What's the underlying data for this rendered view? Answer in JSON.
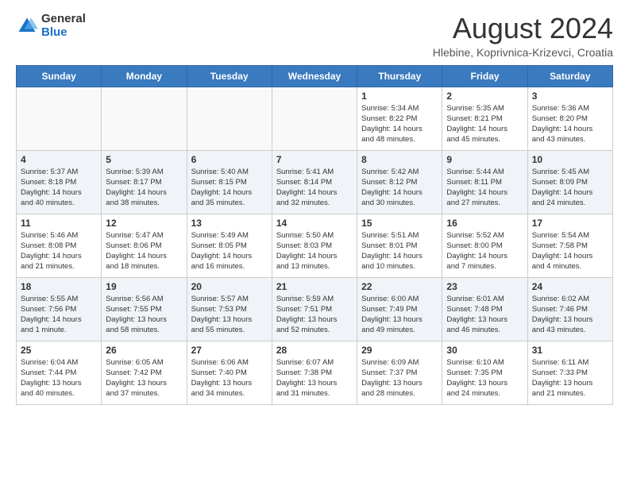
{
  "logo": {
    "general": "General",
    "blue": "Blue"
  },
  "title": "August 2024",
  "location": "Hlebine, Koprivnica-Krizevci, Croatia",
  "days_of_week": [
    "Sunday",
    "Monday",
    "Tuesday",
    "Wednesday",
    "Thursday",
    "Friday",
    "Saturday"
  ],
  "weeks": [
    [
      {
        "day": "",
        "info": ""
      },
      {
        "day": "",
        "info": ""
      },
      {
        "day": "",
        "info": ""
      },
      {
        "day": "",
        "info": ""
      },
      {
        "day": "1",
        "info": "Sunrise: 5:34 AM\nSunset: 8:22 PM\nDaylight: 14 hours\nand 48 minutes."
      },
      {
        "day": "2",
        "info": "Sunrise: 5:35 AM\nSunset: 8:21 PM\nDaylight: 14 hours\nand 45 minutes."
      },
      {
        "day": "3",
        "info": "Sunrise: 5:36 AM\nSunset: 8:20 PM\nDaylight: 14 hours\nand 43 minutes."
      }
    ],
    [
      {
        "day": "4",
        "info": "Sunrise: 5:37 AM\nSunset: 8:18 PM\nDaylight: 14 hours\nand 40 minutes."
      },
      {
        "day": "5",
        "info": "Sunrise: 5:39 AM\nSunset: 8:17 PM\nDaylight: 14 hours\nand 38 minutes."
      },
      {
        "day": "6",
        "info": "Sunrise: 5:40 AM\nSunset: 8:15 PM\nDaylight: 14 hours\nand 35 minutes."
      },
      {
        "day": "7",
        "info": "Sunrise: 5:41 AM\nSunset: 8:14 PM\nDaylight: 14 hours\nand 32 minutes."
      },
      {
        "day": "8",
        "info": "Sunrise: 5:42 AM\nSunset: 8:12 PM\nDaylight: 14 hours\nand 30 minutes."
      },
      {
        "day": "9",
        "info": "Sunrise: 5:44 AM\nSunset: 8:11 PM\nDaylight: 14 hours\nand 27 minutes."
      },
      {
        "day": "10",
        "info": "Sunrise: 5:45 AM\nSunset: 8:09 PM\nDaylight: 14 hours\nand 24 minutes."
      }
    ],
    [
      {
        "day": "11",
        "info": "Sunrise: 5:46 AM\nSunset: 8:08 PM\nDaylight: 14 hours\nand 21 minutes."
      },
      {
        "day": "12",
        "info": "Sunrise: 5:47 AM\nSunset: 8:06 PM\nDaylight: 14 hours\nand 18 minutes."
      },
      {
        "day": "13",
        "info": "Sunrise: 5:49 AM\nSunset: 8:05 PM\nDaylight: 14 hours\nand 16 minutes."
      },
      {
        "day": "14",
        "info": "Sunrise: 5:50 AM\nSunset: 8:03 PM\nDaylight: 14 hours\nand 13 minutes."
      },
      {
        "day": "15",
        "info": "Sunrise: 5:51 AM\nSunset: 8:01 PM\nDaylight: 14 hours\nand 10 minutes."
      },
      {
        "day": "16",
        "info": "Sunrise: 5:52 AM\nSunset: 8:00 PM\nDaylight: 14 hours\nand 7 minutes."
      },
      {
        "day": "17",
        "info": "Sunrise: 5:54 AM\nSunset: 7:58 PM\nDaylight: 14 hours\nand 4 minutes."
      }
    ],
    [
      {
        "day": "18",
        "info": "Sunrise: 5:55 AM\nSunset: 7:56 PM\nDaylight: 14 hours\nand 1 minute."
      },
      {
        "day": "19",
        "info": "Sunrise: 5:56 AM\nSunset: 7:55 PM\nDaylight: 13 hours\nand 58 minutes."
      },
      {
        "day": "20",
        "info": "Sunrise: 5:57 AM\nSunset: 7:53 PM\nDaylight: 13 hours\nand 55 minutes."
      },
      {
        "day": "21",
        "info": "Sunrise: 5:59 AM\nSunset: 7:51 PM\nDaylight: 13 hours\nand 52 minutes."
      },
      {
        "day": "22",
        "info": "Sunrise: 6:00 AM\nSunset: 7:49 PM\nDaylight: 13 hours\nand 49 minutes."
      },
      {
        "day": "23",
        "info": "Sunrise: 6:01 AM\nSunset: 7:48 PM\nDaylight: 13 hours\nand 46 minutes."
      },
      {
        "day": "24",
        "info": "Sunrise: 6:02 AM\nSunset: 7:46 PM\nDaylight: 13 hours\nand 43 minutes."
      }
    ],
    [
      {
        "day": "25",
        "info": "Sunrise: 6:04 AM\nSunset: 7:44 PM\nDaylight: 13 hours\nand 40 minutes."
      },
      {
        "day": "26",
        "info": "Sunrise: 6:05 AM\nSunset: 7:42 PM\nDaylight: 13 hours\nand 37 minutes."
      },
      {
        "day": "27",
        "info": "Sunrise: 6:06 AM\nSunset: 7:40 PM\nDaylight: 13 hours\nand 34 minutes."
      },
      {
        "day": "28",
        "info": "Sunrise: 6:07 AM\nSunset: 7:38 PM\nDaylight: 13 hours\nand 31 minutes."
      },
      {
        "day": "29",
        "info": "Sunrise: 6:09 AM\nSunset: 7:37 PM\nDaylight: 13 hours\nand 28 minutes."
      },
      {
        "day": "30",
        "info": "Sunrise: 6:10 AM\nSunset: 7:35 PM\nDaylight: 13 hours\nand 24 minutes."
      },
      {
        "day": "31",
        "info": "Sunrise: 6:11 AM\nSunset: 7:33 PM\nDaylight: 13 hours\nand 21 minutes."
      }
    ]
  ]
}
